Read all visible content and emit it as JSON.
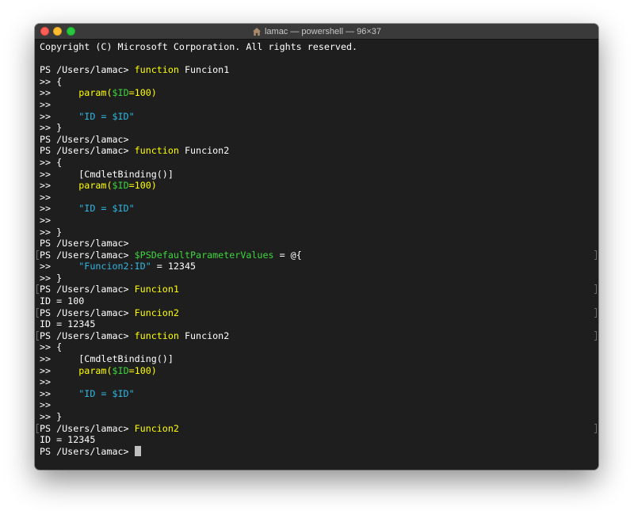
{
  "window": {
    "title": "lamac — powershell — 96×37",
    "title_icon": "home-icon"
  },
  "colors": {
    "background": "#1e1e1e",
    "text": "#ffffff",
    "keyword": "#ffff00",
    "variable": "#3dd63d",
    "string": "#33b6e0",
    "cursor": "#bfbfbf"
  },
  "terminal": {
    "lines": [
      {
        "segments": [
          {
            "text": "Copyright (C) Microsoft Corporation. All rights reserved.",
            "c": "text"
          }
        ]
      },
      {
        "segments": []
      },
      {
        "segments": [
          {
            "text": "PS /Users/lamac> ",
            "c": "text"
          },
          {
            "text": "function",
            "c": "keyword"
          },
          {
            "text": " Funcion1",
            "c": "text"
          }
        ]
      },
      {
        "segments": [
          {
            "text": ">> {",
            "c": "text"
          }
        ]
      },
      {
        "segments": [
          {
            "text": ">>     ",
            "c": "text"
          },
          {
            "text": "param(",
            "c": "keyword"
          },
          {
            "text": "$ID",
            "c": "variable"
          },
          {
            "text": "=100)",
            "c": "keyword"
          }
        ]
      },
      {
        "segments": [
          {
            "text": ">>",
            "c": "text"
          }
        ]
      },
      {
        "segments": [
          {
            "text": ">>     ",
            "c": "text"
          },
          {
            "text": "\"ID = $ID\"",
            "c": "string"
          }
        ]
      },
      {
        "segments": [
          {
            "text": ">> }",
            "c": "text"
          }
        ]
      },
      {
        "segments": [
          {
            "text": "PS /Users/lamac>",
            "c": "text"
          }
        ]
      },
      {
        "segments": [
          {
            "text": "PS /Users/lamac> ",
            "c": "text"
          },
          {
            "text": "function",
            "c": "keyword"
          },
          {
            "text": " Funcion2",
            "c": "text"
          }
        ]
      },
      {
        "segments": [
          {
            "text": ">> {",
            "c": "text"
          }
        ]
      },
      {
        "segments": [
          {
            "text": ">>     [CmdletBinding()]",
            "c": "text"
          }
        ]
      },
      {
        "segments": [
          {
            "text": ">>     ",
            "c": "text"
          },
          {
            "text": "param(",
            "c": "keyword"
          },
          {
            "text": "$ID",
            "c": "variable"
          },
          {
            "text": "=100)",
            "c": "keyword"
          }
        ]
      },
      {
        "segments": [
          {
            "text": ">>",
            "c": "text"
          }
        ]
      },
      {
        "segments": [
          {
            "text": ">>     ",
            "c": "text"
          },
          {
            "text": "\"ID = $ID\"",
            "c": "string"
          }
        ]
      },
      {
        "segments": [
          {
            "text": ">>",
            "c": "text"
          }
        ]
      },
      {
        "segments": [
          {
            "text": ">> }",
            "c": "text"
          }
        ]
      },
      {
        "segments": [
          {
            "text": "PS /Users/lamac>",
            "c": "text"
          }
        ]
      },
      {
        "marked": true,
        "segments": [
          {
            "text": "PS /Users/lamac> ",
            "c": "text"
          },
          {
            "text": "$PSDefaultParameterValues",
            "c": "variable"
          },
          {
            "text": " = @{",
            "c": "text"
          }
        ]
      },
      {
        "segments": [
          {
            "text": ">>     ",
            "c": "text"
          },
          {
            "text": "\"Funcion2:ID\"",
            "c": "string"
          },
          {
            "text": " = 12345",
            "c": "text"
          }
        ]
      },
      {
        "segments": [
          {
            "text": ">> }",
            "c": "text"
          }
        ]
      },
      {
        "marked": true,
        "segments": [
          {
            "text": "PS /Users/lamac> ",
            "c": "text"
          },
          {
            "text": "Funcion1",
            "c": "keyword"
          }
        ]
      },
      {
        "segments": [
          {
            "text": "ID = 100",
            "c": "text"
          }
        ]
      },
      {
        "marked": true,
        "segments": [
          {
            "text": "PS /Users/lamac> ",
            "c": "text"
          },
          {
            "text": "Funcion2",
            "c": "keyword"
          }
        ]
      },
      {
        "segments": [
          {
            "text": "ID = 12345",
            "c": "text"
          }
        ]
      },
      {
        "marked": true,
        "segments": [
          {
            "text": "PS /Users/lamac> ",
            "c": "text"
          },
          {
            "text": "function",
            "c": "keyword"
          },
          {
            "text": " Funcion2",
            "c": "text"
          }
        ]
      },
      {
        "segments": [
          {
            "text": ">> {",
            "c": "text"
          }
        ]
      },
      {
        "segments": [
          {
            "text": ">>     [CmdletBinding()]",
            "c": "text"
          }
        ]
      },
      {
        "segments": [
          {
            "text": ">>     ",
            "c": "text"
          },
          {
            "text": "param(",
            "c": "keyword"
          },
          {
            "text": "$ID",
            "c": "variable"
          },
          {
            "text": "=100)",
            "c": "keyword"
          }
        ]
      },
      {
        "segments": [
          {
            "text": ">>",
            "c": "text"
          }
        ]
      },
      {
        "segments": [
          {
            "text": ">>     ",
            "c": "text"
          },
          {
            "text": "\"ID = $ID\"",
            "c": "string"
          }
        ]
      },
      {
        "segments": [
          {
            "text": ">>",
            "c": "text"
          }
        ]
      },
      {
        "segments": [
          {
            "text": ">> }",
            "c": "text"
          }
        ]
      },
      {
        "marked": true,
        "segments": [
          {
            "text": "PS /Users/lamac> ",
            "c": "text"
          },
          {
            "text": "Funcion2",
            "c": "keyword"
          }
        ]
      },
      {
        "segments": [
          {
            "text": "ID = 12345",
            "c": "text"
          }
        ]
      },
      {
        "cursor": true,
        "segments": [
          {
            "text": "PS /Users/lamac> ",
            "c": "text"
          }
        ]
      }
    ]
  }
}
